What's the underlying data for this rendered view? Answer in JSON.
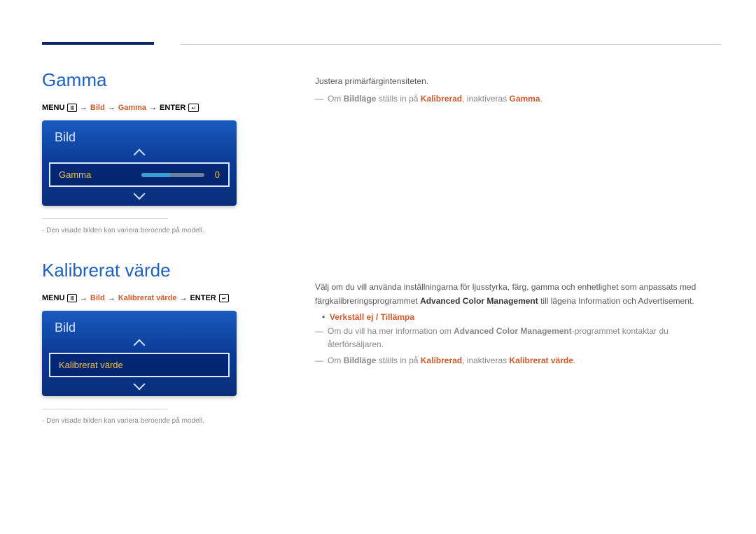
{
  "sections": {
    "gamma": {
      "title": "Gamma",
      "breadcrumb": {
        "menu": "MENU",
        "bild": "Bild",
        "gamma": "Gamma",
        "enter": "ENTER"
      },
      "panel": {
        "header": "Bild",
        "item_label": "Gamma",
        "item_value": "0"
      },
      "footnote": "Den visade bilden kan variera beroende på modell.",
      "body_intro": "Justera primärfärgintensiteten.",
      "note_prefix": "Om",
      "note_bildlage": "Bildläge",
      "note_mid": "ställs in på",
      "note_kalibrerad": "Kalibrerad",
      "note_suffix": ", inaktiveras",
      "note_gamma": "Gamma",
      "note_period": "."
    },
    "kalibrerat": {
      "title": "Kalibrerat värde",
      "breadcrumb": {
        "menu": "MENU",
        "bild": "Bild",
        "kv": "Kalibrerat värde",
        "enter": "ENTER"
      },
      "panel": {
        "header": "Bild",
        "item_label": "Kalibrerat värde"
      },
      "footnote": "Den visade bilden kan variera beroende på modell.",
      "body_p1_a": "Välj om du vill använda inställningarna för ljusstyrka, färg, gamma och enhetlighet som anpassats med färgkalibreringsprogrammet ",
      "body_p1_acm": "Advanced Color Management",
      "body_p1_b": " till lägena Information och Advertisement.",
      "options": "Verkställ ej / Tillämpa",
      "note2_a": "Om du vill ha mer information om ",
      "note2_acm": "Advanced Color Management",
      "note2_b": "-programmet kontaktar du återförsäljaren.",
      "note3_prefix": "Om",
      "note3_bildlage": "Bildläge",
      "note3_mid": "ställs in på",
      "note3_kalibrerad": "Kalibrerad",
      "note3_suffix": ", inaktiveras",
      "note3_kv": "Kalibrerat värde",
      "note3_period": "."
    }
  }
}
